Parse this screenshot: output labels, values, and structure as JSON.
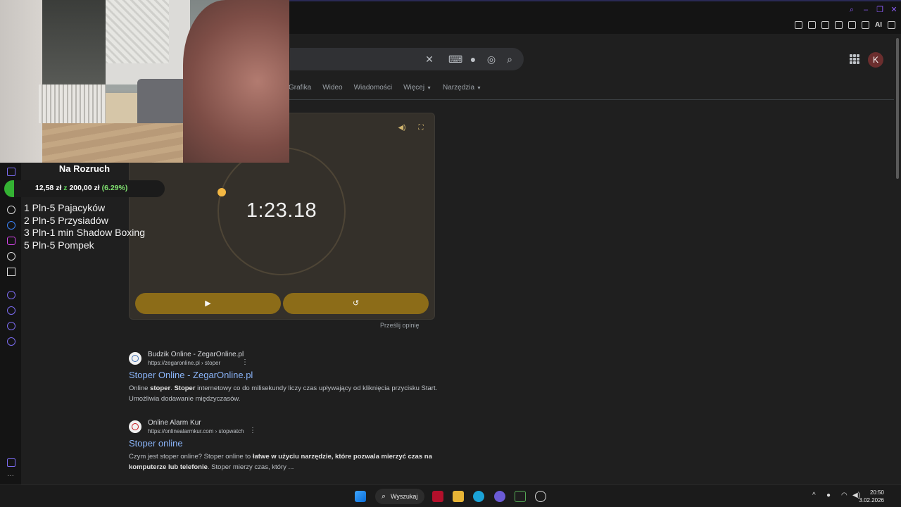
{
  "search": {
    "tabs": [
      "Grafika",
      "Wideo",
      "Wiadomości",
      "Więcej",
      "Narzędzia"
    ],
    "avatar_letter": "K"
  },
  "stopwatch": {
    "time": "1:23.18",
    "start_symbol": "▶",
    "reset_symbol": "↺",
    "feedback": "Prześlij opinię"
  },
  "results": [
    {
      "source": "Budzik Online - ZegarOnline.pl",
      "url": "https://zegaronline.pl › stoper",
      "title": "Stoper Online - ZegarOnline.pl",
      "snippet_html": "Online <b>stoper</b>. <b>Stoper</b> internetowy co do milisekundy liczy czas upływający od kliknięcia przycisku Start. Umożliwia dodawanie międzyczasów."
    },
    {
      "source": "Online Alarm Kur",
      "url": "https://onlinealarmkur.com › stopwatch",
      "title": "Stoper online",
      "snippet_html": "Czym jest stoper online? Stoper online to <b>łatwe w użyciu narzędzie, które pozwala mierzyć czas na komputerze lub telefonie</b>. Stoper mierzy czas, który ..."
    }
  ],
  "overlay": {
    "title": "Na Rozruch",
    "amount": "12,58 zł",
    "sep": "z",
    "goal": "200,00 zł",
    "percent": "(6.29%)",
    "progress_fraction": 0.0629,
    "tasks": [
      "1 Pln-5 Pajacyków",
      "2 Pln-5 Przysiadów",
      "3 Pln-1 min Shadow Boxing",
      "5 Pln-5 Pompek"
    ]
  },
  "taskbar": {
    "search_label": "Wyszukaj",
    "time": "20:50",
    "date": "3.02.2026"
  },
  "colors": {
    "accent_button": "#8c6c18",
    "progress_green": "#34b233",
    "link_blue": "#8ab4f8"
  }
}
